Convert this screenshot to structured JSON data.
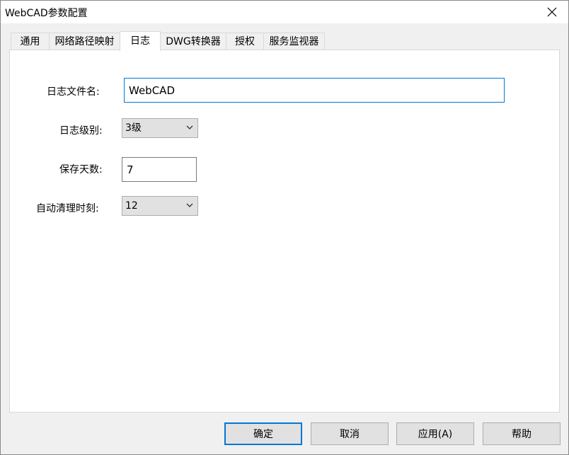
{
  "window": {
    "title": "WebCAD参数配置"
  },
  "tabs": [
    {
      "label": "通用"
    },
    {
      "label": "网络路径映射"
    },
    {
      "label": "日志"
    },
    {
      "label": "DWG转换器"
    },
    {
      "label": "授权"
    },
    {
      "label": "服务监视器"
    }
  ],
  "active_tab": "日志",
  "form": {
    "log_filename": {
      "label": "日志文件名:",
      "value": "WebCAD"
    },
    "log_level": {
      "label": "日志级别:",
      "value": "3级"
    },
    "retention_days": {
      "label": "保存天数:",
      "value": "7"
    },
    "auto_clean_time": {
      "label": "自动清理时刻:",
      "value": "12"
    }
  },
  "buttons": {
    "ok": "确定",
    "cancel": "取消",
    "apply": "应用(A)",
    "help": "帮助"
  },
  "icons": {
    "close": "close-icon",
    "dropdown": "chevron-down-icon"
  },
  "colors": {
    "focus_border": "#0078d7",
    "button_face": "#e1e1e1",
    "window_face": "#f0f0f0"
  }
}
